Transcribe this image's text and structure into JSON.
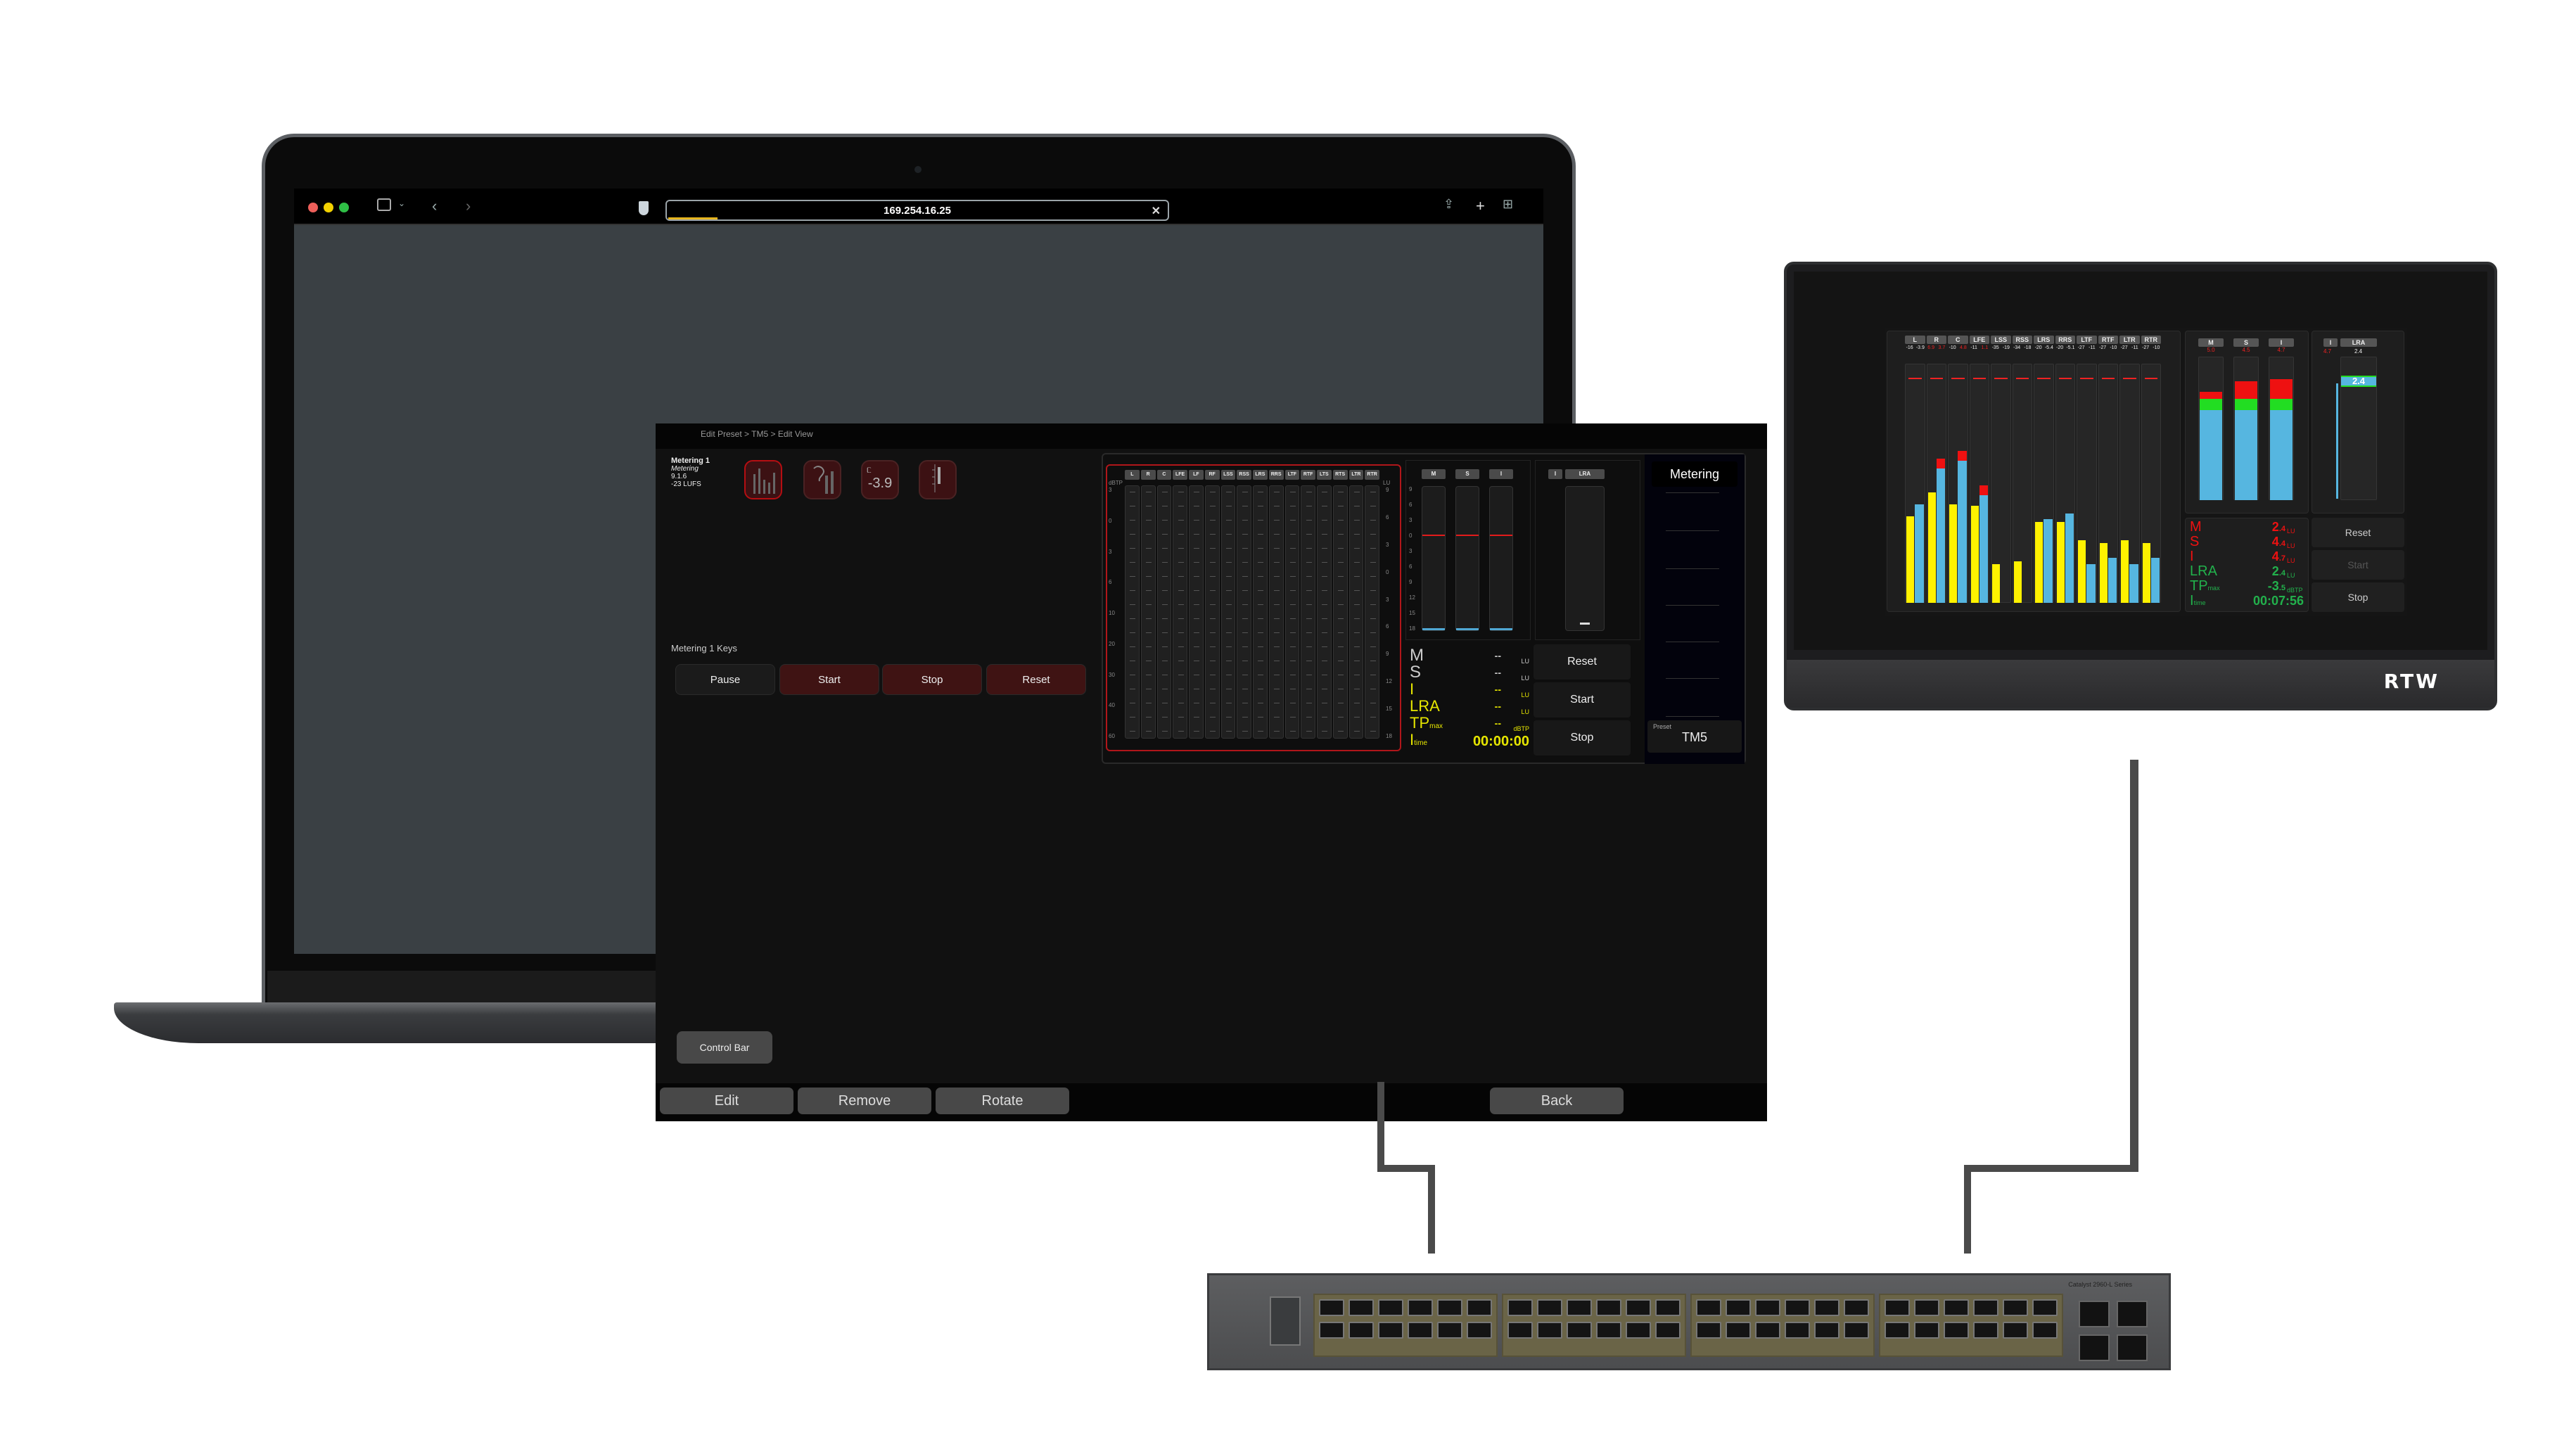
{
  "browser": {
    "url": "169.254.16.25",
    "load_progress_percent": 12,
    "icons": [
      "sidebar-icon",
      "chevron-down-icon",
      "back-icon",
      "forward-icon",
      "shield-icon",
      "share-icon",
      "new-tab-icon",
      "tab-overview-icon"
    ]
  },
  "app": {
    "breadcrumb": "Edit Preset > TM5 > Edit View",
    "meter_info": {
      "title": "Metering 1",
      "type": "Metering",
      "version": "9.1.6",
      "target": "-23 LUFS"
    },
    "view_icons": [
      {
        "name": "bargraph-view",
        "selected": true
      },
      {
        "name": "loudness-bar-view",
        "selected": false
      },
      {
        "name": "loudness-numeric-view",
        "label": "-3.9",
        "selected": false
      },
      {
        "name": "scale-view",
        "selected": false
      }
    ],
    "keys_label": "Metering 1 Keys",
    "keys": [
      "Pause",
      "Start",
      "Stop",
      "Reset"
    ],
    "control_bar_label": "Control Bar",
    "bottom_buttons": {
      "edit": "Edit",
      "remove": "Remove",
      "rotate": "Rotate",
      "back": "Back"
    }
  },
  "preview": {
    "channels": [
      "L",
      "R",
      "C",
      "LFE",
      "LF",
      "RF",
      "LSS",
      "RSS",
      "LRS",
      "RRS",
      "LTF",
      "RTF",
      "LTS",
      "RTS",
      "LTR",
      "RTR"
    ],
    "dbtp_unit": "dBTP",
    "dbtp_scale": [
      "3",
      "0",
      "3",
      "6",
      "10",
      "20",
      "30",
      "40",
      "60"
    ],
    "lu_unit": "LU",
    "lu_scale": [
      "9",
      "6",
      "3",
      "0",
      "3",
      "6",
      "9",
      "12",
      "15",
      "18"
    ],
    "loudness_labels": [
      "M",
      "S",
      "I"
    ],
    "lra_labels": [
      "I",
      "LRA"
    ],
    "readings": [
      {
        "label": "M",
        "value": "--",
        "unit": "LU"
      },
      {
        "label": "S",
        "value": "--",
        "unit": "LU"
      },
      {
        "label": "I",
        "value": "--",
        "unit": "LU"
      },
      {
        "label": "LRA",
        "value": "--",
        "unit": "LU"
      },
      {
        "label": "TP",
        "sub": "max",
        "value": "--",
        "unit": "dBTP"
      },
      {
        "label": "I",
        "sub": "time",
        "value": "00:00:00",
        "unit": ""
      }
    ],
    "buttons": [
      "Reset",
      "Start",
      "Stop"
    ],
    "metering_title": "Metering",
    "preset_caption": "Preset",
    "preset_value": "TM5"
  },
  "rtw_device": {
    "brand": "RTW",
    "channels": [
      {
        "name": "L",
        "peak_a": "-16",
        "peak_b": "-3.9",
        "over_a": false,
        "over_b": false,
        "a_db": 21,
        "b_db": 17
      },
      {
        "name": "R",
        "peak_a": "6.9",
        "peak_b": "3.7",
        "over_a": true,
        "over_b": true,
        "a_db": 13,
        "b_db": 8
      },
      {
        "name": "C",
        "peak_a": "-10",
        "peak_b": "4.8",
        "over_a": false,
        "over_b": true,
        "a_db": 17,
        "b_db": 7
      },
      {
        "name": "LFE",
        "peak_a": "-11",
        "peak_b": "1.1",
        "over_a": false,
        "over_b": true,
        "a_db": 17.5,
        "b_db": 14
      },
      {
        "name": "LSS",
        "peak_a": "-35",
        "peak_b": "-19",
        "over_a": false,
        "over_b": false,
        "a_db": 37,
        "b_db": 60
      },
      {
        "name": "RSS",
        "peak_a": "-34",
        "peak_b": "-18",
        "over_a": false,
        "over_b": false,
        "a_db": 36,
        "b_db": 60
      },
      {
        "name": "LRS",
        "peak_a": "-20",
        "peak_b": "-5.4",
        "over_a": false,
        "over_b": false,
        "a_db": 23,
        "b_db": 22
      },
      {
        "name": "RRS",
        "peak_a": "-20",
        "peak_b": "-5.1",
        "over_a": false,
        "over_b": false,
        "a_db": 23,
        "b_db": 20
      },
      {
        "name": "LTF",
        "peak_a": "-27",
        "peak_b": "-11",
        "over_a": false,
        "over_b": false,
        "a_db": 29,
        "b_db": 37
      },
      {
        "name": "RTF",
        "peak_a": "-27",
        "peak_b": "-10",
        "over_a": false,
        "over_b": false,
        "a_db": 30,
        "b_db": 35
      },
      {
        "name": "LTR",
        "peak_a": "-27",
        "peak_b": "-11",
        "over_a": false,
        "over_b": false,
        "a_db": 29,
        "b_db": 37
      },
      {
        "name": "RTR",
        "peak_a": "-27",
        "peak_b": "-10",
        "over_a": false,
        "over_b": false,
        "a_db": 30,
        "b_db": 35
      }
    ],
    "loudness_bars": [
      {
        "name": "M",
        "peak": "5.0",
        "value_lu": 2.4
      },
      {
        "name": "S",
        "peak": "4.5",
        "value_lu": 4.4
      },
      {
        "name": "I",
        "peak": "4.7",
        "value_lu": 4.7
      }
    ],
    "lra": {
      "i_peak": "4.7",
      "value": "2.4"
    },
    "readings": [
      {
        "label": "M",
        "int": "2",
        "dec": ".4",
        "unit": "LU",
        "color": "red"
      },
      {
        "label": "S",
        "int": "4",
        "dec": ".4",
        "unit": "LU",
        "color": "red"
      },
      {
        "label": "I",
        "int": "4",
        "dec": ".7",
        "unit": "LU",
        "color": "red"
      },
      {
        "label": "LRA",
        "int": "2",
        "dec": ".4",
        "unit": "LU",
        "color": "green"
      },
      {
        "label": "TP",
        "sub": "max",
        "int": "-3",
        "dec": ".5",
        "unit": "dBTP",
        "color": "green"
      },
      {
        "label": "I",
        "sub": "time",
        "int": "00:07:56",
        "dec": "",
        "unit": "",
        "color": "green"
      }
    ],
    "buttons": [
      {
        "label": "Reset",
        "enabled": true
      },
      {
        "label": "Start",
        "enabled": false
      },
      {
        "label": "Stop",
        "enabled": true
      }
    ]
  },
  "network_switch": {
    "model_label": "Catalyst 2960-L Series"
  },
  "colors": {
    "accent_red": "#b50e12",
    "meter_yellow": "#fff200",
    "meter_blue": "#56b6e0",
    "meter_red": "#ee1111",
    "meter_green": "#22dd22",
    "reading_green": "#22b14c",
    "reading_yellow": "#e6e600"
  }
}
